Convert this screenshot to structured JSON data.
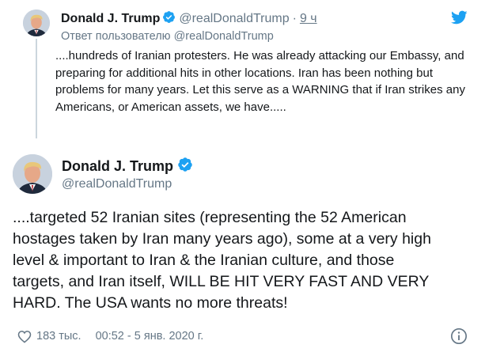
{
  "reply_tweet": {
    "author_name": "Donald J. Trump",
    "handle": "@realDonaldTrump",
    "separator": "·",
    "time": "9 ч",
    "reply_to": "Ответ пользователю @realDonaldTrump",
    "text": "....hundreds of Iranian protesters. He was already attacking our Embassy, and preparing for additional hits in other locations. Iran has been nothing but problems for many years. Let this serve as a WARNING that if Iran strikes any Americans, or American assets, we have....."
  },
  "main_tweet": {
    "author_name": "Donald J. Trump",
    "handle": "@realDonaldTrump",
    "text": "....targeted 52 Iranian sites (representing the 52 American\nhostages taken by Iran many years ago), some at a very high\nlevel & important to Iran &  the Iranian culture, and those\ntargets, and Iran itself, WILL BE HIT VERY FAST AND VERY\nHARD. The USA wants no more threats!",
    "likes": "183 тыс.",
    "timestamp": "00:52 - 5 янв. 2020 г."
  },
  "icons": {
    "verified": "verified-badge-icon",
    "brand": "twitter-bird-icon",
    "like": "heart-icon",
    "info": "info-icon"
  },
  "colors": {
    "brand_blue": "#1da1f2",
    "secondary_text": "#657786",
    "primary_text": "#14171a",
    "thread_line": "#ccd6dd"
  }
}
